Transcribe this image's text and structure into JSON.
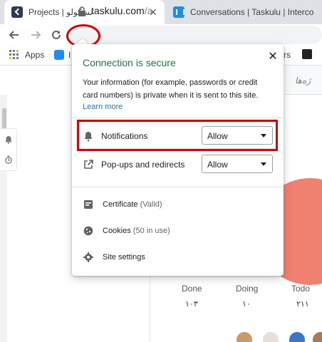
{
  "tabs": [
    {
      "title": "Projects | تسکولو",
      "close": "✕"
    },
    {
      "title": "Conversations | Taskulu | Interco",
      "close": "✕"
    }
  ],
  "toolbar": {
    "url_host": "taskulu.com",
    "url_path": "/a"
  },
  "bookmarks": {
    "apps_label": "Apps",
    "second_label": "I",
    "third_label": "rs"
  },
  "page": {
    "rtl_text": "ژه‌ها",
    "stats": [
      {
        "label": "Done",
        "value": "۱۰۳"
      },
      {
        "label": "Doing",
        "value": "۱۰"
      },
      {
        "label": "Todo",
        "value": "۲۱۱"
      }
    ]
  },
  "popup": {
    "title": "Connection is secure",
    "description": "Your information (for example, passwords or credit card numbers) is private when it is sent to this site.",
    "learn_more": "Learn more",
    "close": "✕",
    "permissions": [
      {
        "label": "Notifications",
        "value": "Allow",
        "icon": "bell-icon"
      },
      {
        "label": "Pop-ups and redirects",
        "value": "Allow",
        "icon": "popup-icon"
      }
    ],
    "certificate_label": "Certificate",
    "certificate_status": "(Valid)",
    "cookies_label": "Cookies",
    "cookies_status": "(50 in use)",
    "site_settings_label": "Site settings"
  },
  "colors": {
    "secure_green": "#188038",
    "link_blue": "#1a73e8",
    "annotation_red": "#e00000",
    "chart_salmon": "#f08070"
  }
}
